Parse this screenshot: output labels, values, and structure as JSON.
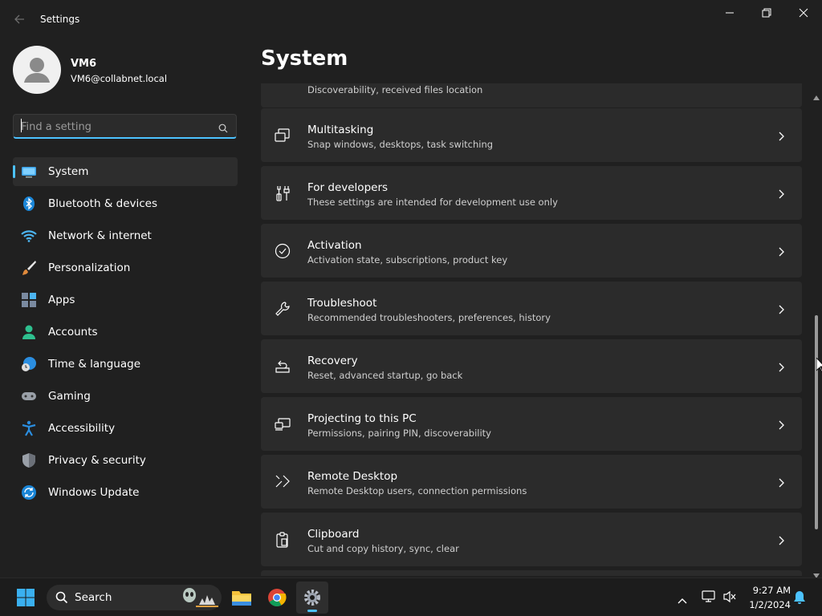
{
  "window": {
    "title": "Settings"
  },
  "user": {
    "name": "VM6",
    "email": "VM6@collabnet.local"
  },
  "search": {
    "placeholder": "Find a setting"
  },
  "nav": [
    {
      "label": "System",
      "icon": "monitor-icon",
      "selected": true
    },
    {
      "label": "Bluetooth & devices",
      "icon": "bluetooth-icon"
    },
    {
      "label": "Network & internet",
      "icon": "wifi-icon"
    },
    {
      "label": "Personalization",
      "icon": "paintbrush-icon"
    },
    {
      "label": "Apps",
      "icon": "apps-icon"
    },
    {
      "label": "Accounts",
      "icon": "person-icon"
    },
    {
      "label": "Time & language",
      "icon": "globe-clock-icon"
    },
    {
      "label": "Gaming",
      "icon": "gamepad-icon"
    },
    {
      "label": "Accessibility",
      "icon": "accessibility-icon"
    },
    {
      "label": "Privacy & security",
      "icon": "shield-icon"
    },
    {
      "label": "Windows Update",
      "icon": "update-icon"
    }
  ],
  "page": {
    "title": "System"
  },
  "cards": [
    {
      "title": "",
      "desc": "Discoverability, received files location",
      "icon": "nearby-sharing-icon"
    },
    {
      "title": "Multitasking",
      "desc": "Snap windows, desktops, task switching",
      "icon": "multitasking-icon"
    },
    {
      "title": "For developers",
      "desc": "These settings are intended for development use only",
      "icon": "developer-tools-icon"
    },
    {
      "title": "Activation",
      "desc": "Activation state, subscriptions, product key",
      "icon": "check-circle-icon"
    },
    {
      "title": "Troubleshoot",
      "desc": "Recommended troubleshooters, preferences, history",
      "icon": "wrench-icon"
    },
    {
      "title": "Recovery",
      "desc": "Reset, advanced startup, go back",
      "icon": "recovery-icon"
    },
    {
      "title": "Projecting to this PC",
      "desc": "Permissions, pairing PIN, discoverability",
      "icon": "projecting-icon"
    },
    {
      "title": "Remote Desktop",
      "desc": "Remote Desktop users, connection permissions",
      "icon": "remote-desktop-icon"
    },
    {
      "title": "Clipboard",
      "desc": "Cut and copy history, sync, clear",
      "icon": "clipboard-icon"
    }
  ],
  "taskbar": {
    "search_label": "Search",
    "time": "9:27 AM",
    "date": "1/2/2024"
  },
  "colors": {
    "accent": "#4cc2ff",
    "background": "#202020",
    "card": "#2b2b2b",
    "taskbar": "#1c1c1c"
  }
}
